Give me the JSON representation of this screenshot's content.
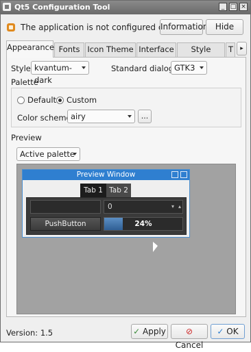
{
  "window": {
    "title": "Qt5 Configuration Tool"
  },
  "notice": {
    "text": "The application is not configured correctly.",
    "info_label": "Information",
    "hide_label": "Hide"
  },
  "tabs": [
    {
      "label": "Appearance"
    },
    {
      "label": "Fonts"
    },
    {
      "label": "Icon Theme"
    },
    {
      "label": "Interface"
    },
    {
      "label": "Style Sheets"
    },
    {
      "label": "T"
    }
  ],
  "appearance": {
    "style_label": "Style:",
    "style_value": "kvantum-dark",
    "dialogs_label": "Standard dialogs:",
    "dialogs_value": "GTK3",
    "palette_title": "Palette",
    "default_label": "Default",
    "custom_label": "Custom",
    "scheme_label": "Color scheme:",
    "scheme_value": "airy",
    "scheme_more": "...",
    "preview_title": "Preview",
    "preview_combo": "Active palette"
  },
  "preview_window": {
    "title": "Preview Window",
    "tab1": "Tab 1",
    "tab2": "Tab 2",
    "spin_value": "0",
    "push_label": "PushButton",
    "progress_text": "24%",
    "progress_fraction": 0.24
  },
  "footer": {
    "version": "Version: 1.5",
    "apply_label": "Apply",
    "cancel_label": "Cancel",
    "ok_label": "OK"
  }
}
